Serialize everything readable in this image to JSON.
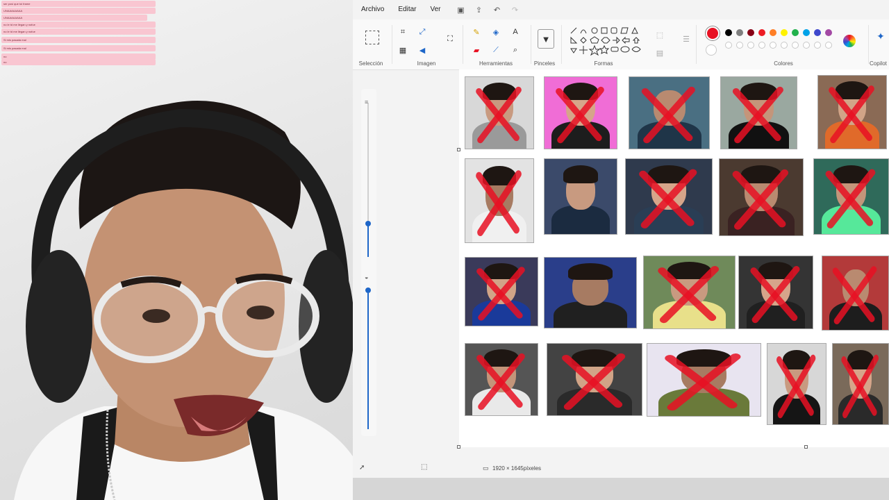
{
  "chat": [
    "ser posi que toi frame",
    "UNAAAAAAAA",
    "no le td me llegan y nofue",
    "Si mis pasada mal",
    "no"
  ],
  "menu": {
    "archivo": "Archivo",
    "editar": "Editar",
    "ver": "Ver"
  },
  "ribbon": {
    "seleccion": "Selección",
    "imagen": "Imagen",
    "herramientas": "Herramientas",
    "pinceles": "Pinceles",
    "formas": "Formas",
    "colores": "Colores",
    "copilot": "Copilot"
  },
  "colors": {
    "primary": "#e81123",
    "palette_row1": [
      "#000000",
      "#7f7f7f",
      "#880015",
      "#ed1c24",
      "#ff7f27",
      "#fff200",
      "#22b14c",
      "#00a2e8",
      "#3f48cc",
      "#a349a4"
    ],
    "palette_row2": [
      "#ffffff",
      "#c3c3c3",
      "#b97a57",
      "#ffaec9",
      "#ffc90e",
      "#efe4b0",
      "#b5e61d",
      "#99d9ea",
      "#7092be",
      "#c8bfe7"
    ]
  },
  "status": {
    "dimensions": "1920 × 1645píxeles"
  },
  "photos_crossed": [
    true,
    true,
    true,
    true,
    true,
    true,
    false,
    true,
    true,
    true,
    true,
    false,
    true,
    true,
    true,
    true,
    true,
    true,
    true,
    true,
    true
  ]
}
